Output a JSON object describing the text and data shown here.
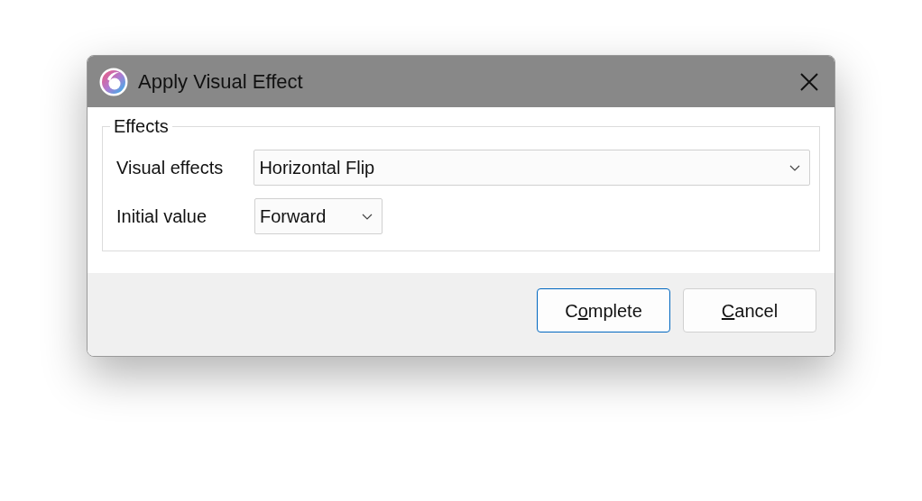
{
  "window": {
    "title": "Apply Visual Effect"
  },
  "group": {
    "title": "Effects",
    "fields": [
      {
        "label": "Visual effects",
        "value": "Horizontal Flip",
        "kind": "wide"
      },
      {
        "label": "Initial value",
        "value": "Forward",
        "kind": "narrow"
      }
    ]
  },
  "buttons": [
    {
      "label_parts": [
        {
          "text": "C",
          "underlined": false
        },
        {
          "text": "o",
          "underlined": true
        },
        {
          "text": "mplete",
          "underlined": false
        }
      ],
      "default": true
    },
    {
      "label_parts": [
        {
          "text": "C",
          "underlined": true
        },
        {
          "text": "ancel",
          "underlined": false
        }
      ],
      "default": false
    }
  ]
}
